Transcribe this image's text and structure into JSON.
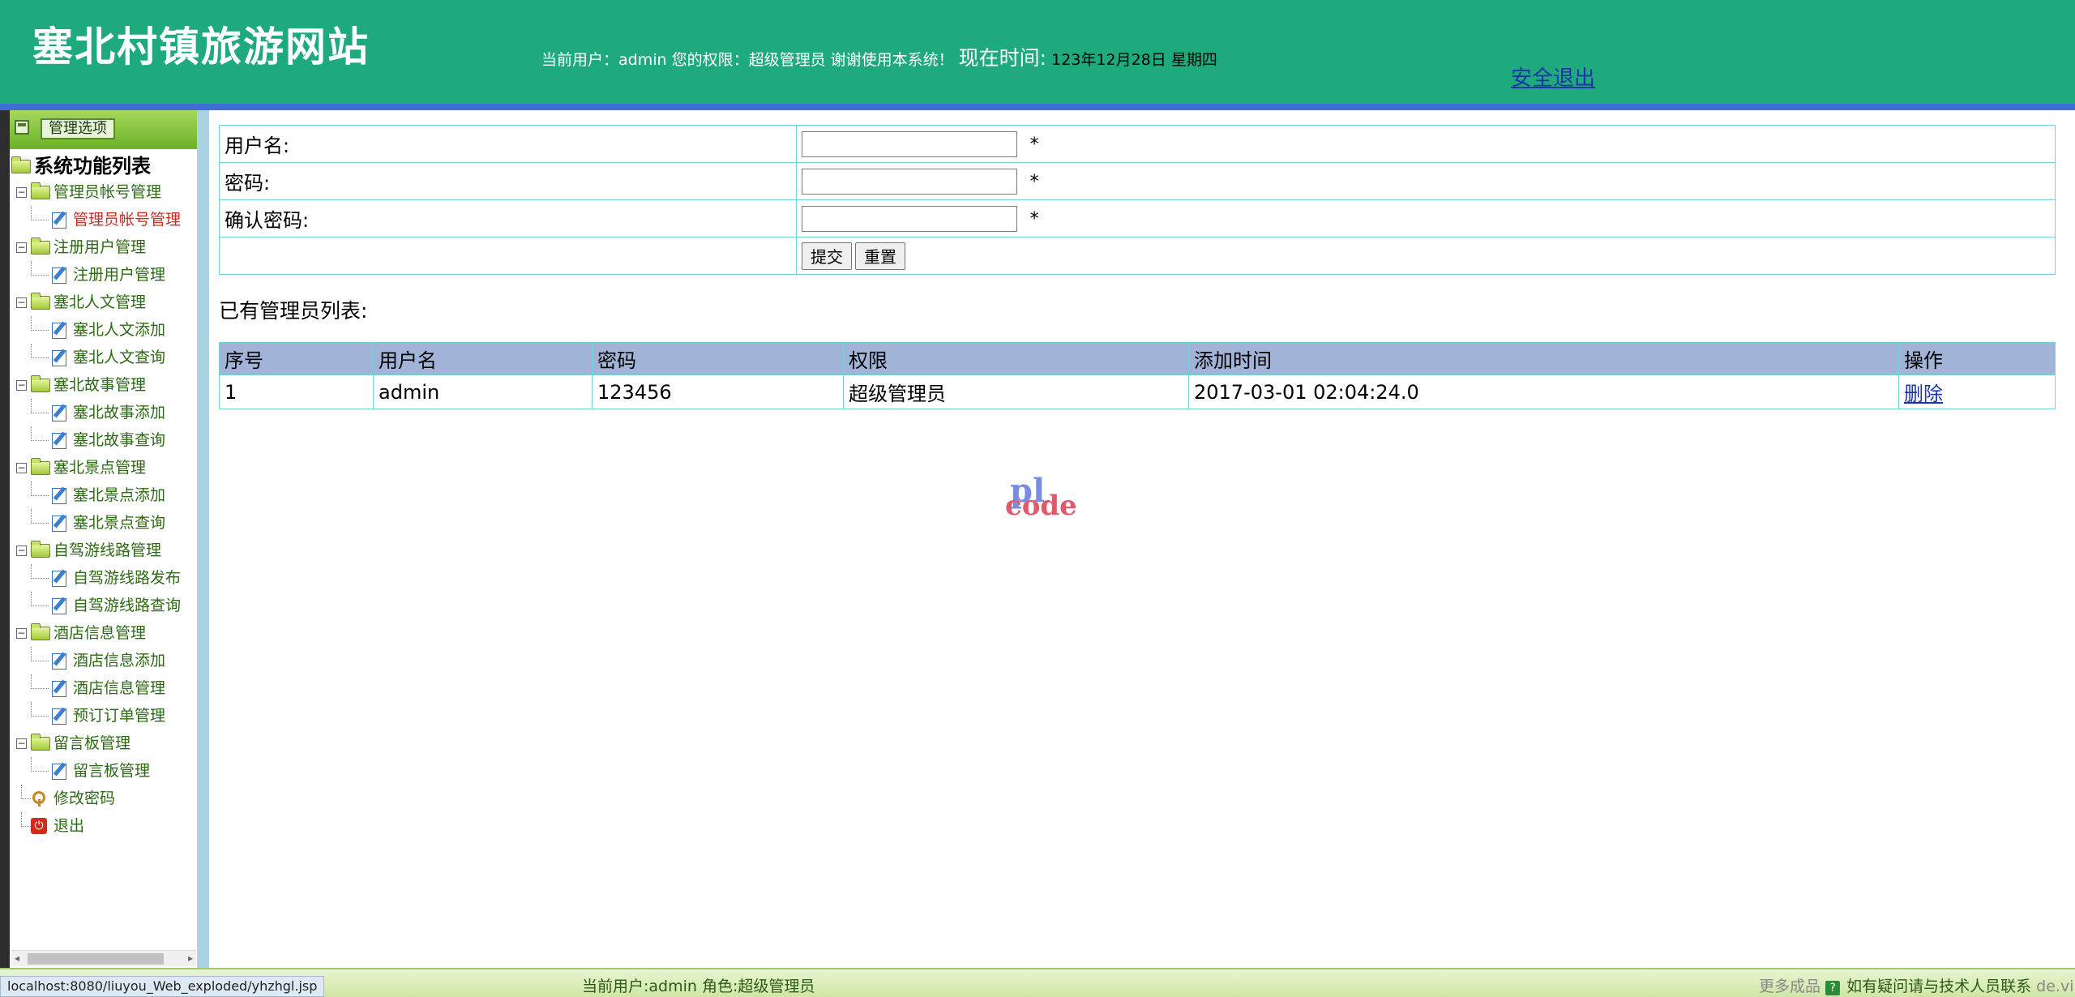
{
  "header": {
    "site_title": "塞北村镇旅游网站",
    "user_info": "当前用户：admin 您的权限：超级管理员 谢谢使用本系统！",
    "time_label": "现在时间:",
    "time_value": "123年12月28日 星期四",
    "logout": "安全退出"
  },
  "sidebar": {
    "header_button": "管理选项",
    "root": "系统功能列表",
    "groups": [
      {
        "label": "管理员帐号管理",
        "items": [
          "管理员帐号管理"
        ]
      },
      {
        "label": "注册用户管理",
        "items": [
          "注册用户管理"
        ]
      },
      {
        "label": "塞北人文管理",
        "items": [
          "塞北人文添加",
          "塞北人文查询"
        ]
      },
      {
        "label": "塞北故事管理",
        "items": [
          "塞北故事添加",
          "塞北故事查询"
        ]
      },
      {
        "label": "塞北景点管理",
        "items": [
          "塞北景点添加",
          "塞北景点查询"
        ]
      },
      {
        "label": "自驾游线路管理",
        "items": [
          "自驾游线路发布",
          "自驾游线路查询"
        ]
      },
      {
        "label": "酒店信息管理",
        "items": [
          "酒店信息添加",
          "酒店信息管理",
          "预订订单管理"
        ]
      },
      {
        "label": "留言板管理",
        "items": [
          "留言板管理"
        ]
      }
    ],
    "change_password": "修改密码",
    "exit": "退出"
  },
  "form": {
    "username_label": "用户名:",
    "password_label": "密码:",
    "confirm_label": "确认密码:",
    "required_mark": "*",
    "submit": "提交",
    "reset": "重置"
  },
  "list": {
    "title": "已有管理员列表:",
    "headers": [
      "序号",
      "用户名",
      "密码",
      "权限",
      "添加时间",
      "操作"
    ],
    "rows": [
      {
        "index": "1",
        "username": "admin",
        "password": "123456",
        "role": "超级管理员",
        "added": "2017-03-01 02:04:24.0",
        "action": "删除"
      }
    ]
  },
  "watermark": {
    "top": "pl",
    "bottom": "code"
  },
  "footer": {
    "url": "localhost:8080/liuyou_Web_exploded/yhzhgl.jsp",
    "current_user": "当前用户:admin  角色:超级管理员",
    "more": "更多成品",
    "help": "如有疑问请与技术人员联系",
    "faded_tail": "de.vi"
  },
  "colors": {
    "header": "#1faa7d",
    "table_header": "#a1b4d8",
    "border": "#6fd3d9",
    "link": "#1a35a8"
  }
}
